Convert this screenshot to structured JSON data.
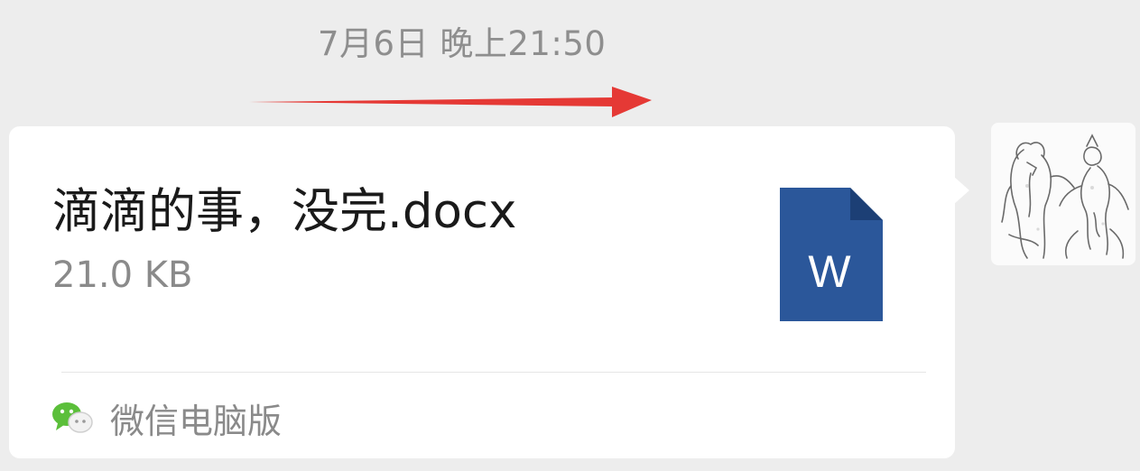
{
  "timestamp": "7月6日 晚上21:50",
  "message": {
    "file_name": "滴滴的事，没完.docx",
    "file_size": "21.0 KB",
    "file_icon_letter": "W",
    "file_icon_color": "#2b579a",
    "source_label": "微信电脑版",
    "source_icon": "wechat-icon"
  },
  "annotation_arrow_color": "#e53935",
  "avatar": "avatar-icon"
}
